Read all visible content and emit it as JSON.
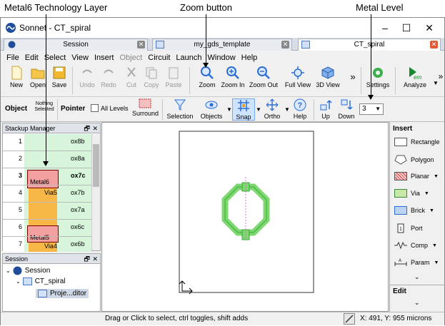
{
  "annotations": {
    "metal6": "Metal6 Technology Layer",
    "zoom": "Zoom button",
    "metal_level": "Metal Level"
  },
  "window": {
    "title": "Sonnet - CT_spiral"
  },
  "tabs": [
    {
      "label": "Session"
    },
    {
      "label": "my_gds_template"
    },
    {
      "label": "CT_spiral"
    }
  ],
  "menu": [
    "File",
    "Edit",
    "Select",
    "View",
    "Insert",
    "Object",
    "Circuit",
    "Launch",
    "Window",
    "Help"
  ],
  "toolbar": {
    "new": "New",
    "open": "Open",
    "save": "Save",
    "undo": "Undo",
    "redo": "Redo",
    "cut": "Cut",
    "copy": "Copy",
    "paste": "Paste",
    "zoom": "Zoom",
    "zoom_in": "Zoom In",
    "zoom_out": "Zoom Out",
    "full_view": "Full View",
    "view3d": "3D View",
    "settings": "Settings",
    "analyze": "Analyze",
    "overflow": "»"
  },
  "toolbar2": {
    "object": "Object",
    "nothing_selected": "Nothing Selected",
    "pointer": "Pointer",
    "all_levels": "All Levels",
    "surround": "Surround",
    "selection": "Selection",
    "objects": "Objects",
    "snap": "Snap",
    "ortho": "Ortho",
    "help": "Help",
    "up": "Up",
    "down": "Down",
    "level_value": "3"
  },
  "stackup": {
    "title": "Stackup Manager",
    "rows": [
      {
        "num": "1",
        "name": "ox8b"
      },
      {
        "num": "2",
        "name": "ox8a"
      },
      {
        "num": "3",
        "name": "ox7c"
      },
      {
        "num": "4",
        "name": "ox7b"
      },
      {
        "num": "5",
        "name": "ox7a"
      },
      {
        "num": "6",
        "name": "ox6c"
      },
      {
        "num": "7",
        "name": "ox6b"
      }
    ],
    "labels": {
      "metal6": "Metal6",
      "via5": "Via5",
      "metal5": "Metal5",
      "via4": "Via4"
    }
  },
  "session": {
    "title": "Session",
    "items": [
      {
        "label": "Session"
      },
      {
        "label": "CT_spiral"
      },
      {
        "label": "Proje...ditor"
      }
    ]
  },
  "insert": {
    "header": "Insert",
    "items": [
      "Rectangle",
      "Polygon",
      "Planar",
      "Via",
      "Brick",
      "Port",
      "Comp",
      "Param"
    ],
    "edit": "Edit"
  },
  "status": {
    "hint": "Drag or Click to select, ctrl toggles, shift adds",
    "coords": "X: 491, Y: 955 microns"
  },
  "colors": {
    "metal6": "#f2a0a0",
    "via": "#f8b848",
    "canvas_metal": "#7ed870",
    "accent": "#2a6dd8"
  }
}
